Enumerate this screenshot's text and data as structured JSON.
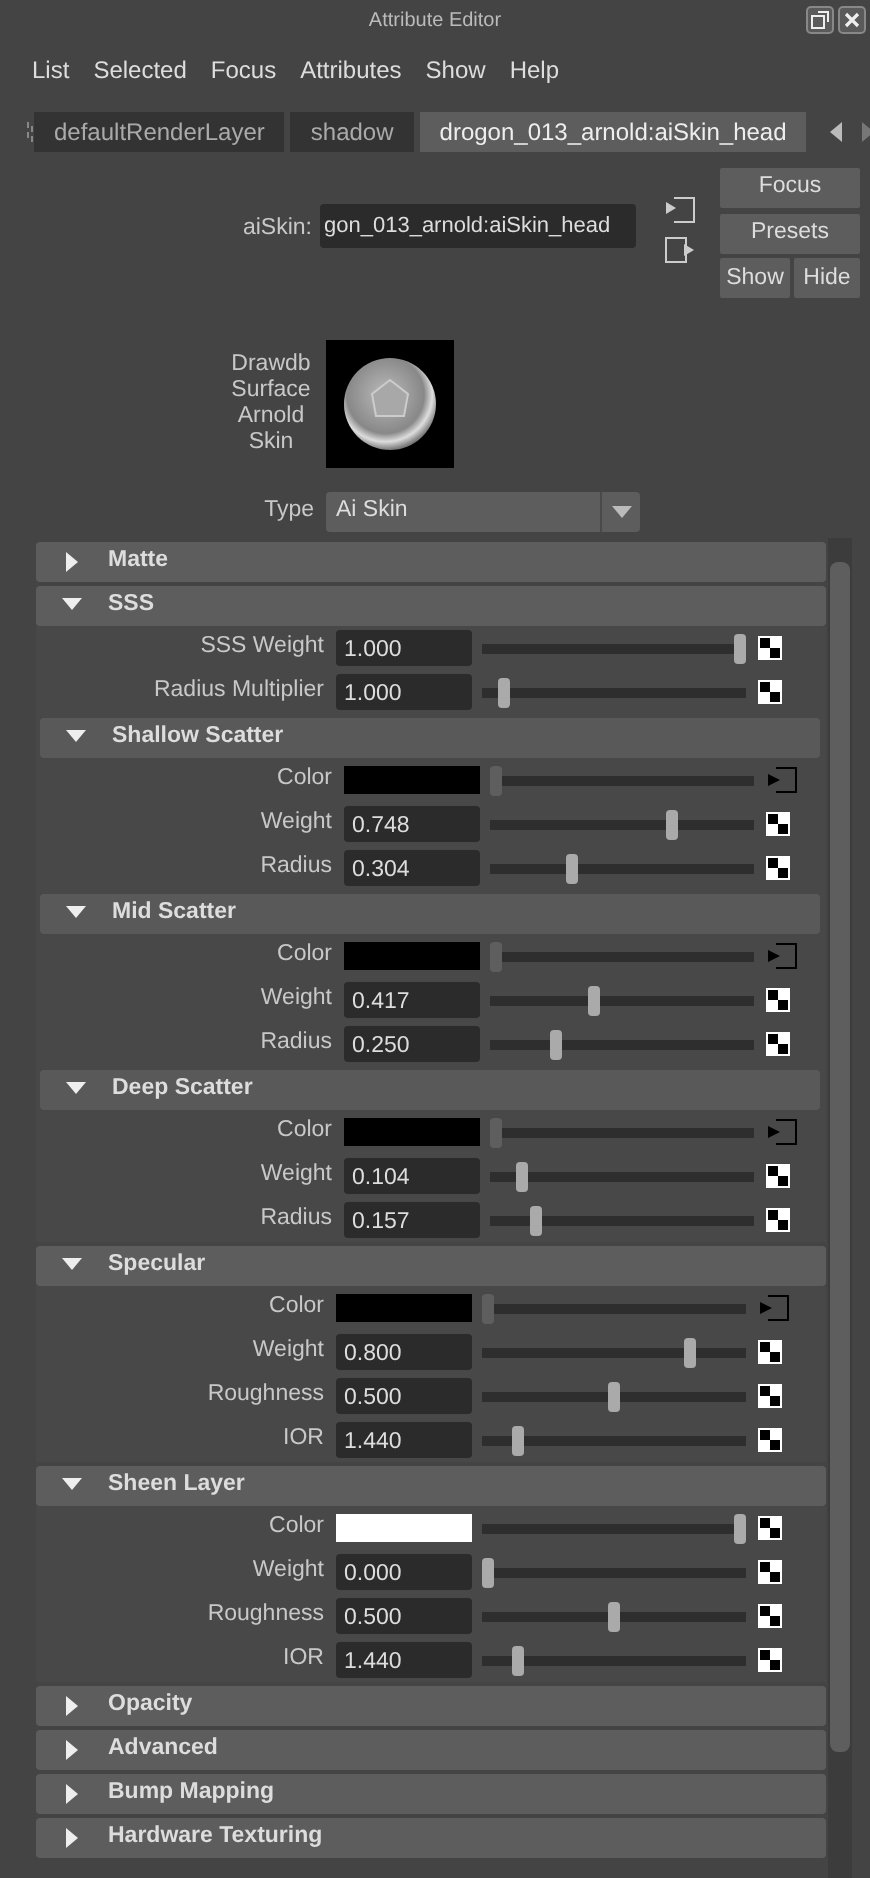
{
  "window": {
    "title": "Attribute Editor"
  },
  "menu": [
    "List",
    "Selected",
    "Focus",
    "Attributes",
    "Show",
    "Help"
  ],
  "tabs": [
    {
      "label": "defaultRenderLayer",
      "selected": false
    },
    {
      "label": "shadow",
      "selected": false
    },
    {
      "label": "drogon_013_arnold:aiSkin_head",
      "selected": true
    }
  ],
  "node": {
    "label": "aiSkin:",
    "value": "gon_013_arnold:aiSkin_head"
  },
  "buttons": [
    "Focus",
    "Presets",
    "Show",
    "Hide"
  ],
  "swatch": {
    "label": "Drawdb Surface Arnold Skin"
  },
  "type": {
    "label": "Type",
    "value": "Ai Skin"
  },
  "sections": [
    {
      "title": "Matte",
      "expanded": false
    },
    {
      "title": "SSS",
      "expanded": true,
      "attributes": [
        {
          "kind": "number",
          "label": "SSS Weight",
          "value": "1.000",
          "level": 1.0,
          "map_button": {
            "kind": "checker"
          }
        },
        {
          "kind": "number",
          "label": "Radius Multiplier",
          "value": "1.000",
          "level": 0.06,
          "map_button": {
            "kind": "checker"
          }
        }
      ],
      "subsections": [
        {
          "title": "Shallow Scatter",
          "expanded": true,
          "attributes": [
            {
              "kind": "color",
              "label": "Color",
              "color": "#000000",
              "level": 0,
              "map_button": {
                "kind": "output"
              }
            },
            {
              "kind": "number",
              "label": "Weight",
              "value": "0.748",
              "level": 0.7,
              "map_button": {
                "kind": "checker"
              }
            },
            {
              "kind": "number",
              "label": "Radius",
              "value": "0.304",
              "level": 0.3,
              "map_button": {
                "kind": "checker"
              }
            }
          ]
        },
        {
          "title": "Mid Scatter",
          "expanded": true,
          "attributes": [
            {
              "kind": "color",
              "label": "Color",
              "color": "#000000",
              "level": 0,
              "map_button": {
                "kind": "output"
              }
            },
            {
              "kind": "number",
              "label": "Weight",
              "value": "0.417",
              "level": 0.39,
              "map_button": {
                "kind": "checker"
              }
            },
            {
              "kind": "number",
              "label": "Radius",
              "value": "0.250",
              "level": 0.24,
              "map_button": {
                "kind": "checker"
              }
            }
          ]
        },
        {
          "title": "Deep Scatter",
          "expanded": true,
          "attributes": [
            {
              "kind": "color",
              "label": "Color",
              "color": "#000000",
              "level": 0,
              "map_button": {
                "kind": "output"
              }
            },
            {
              "kind": "number",
              "label": "Weight",
              "value": "0.104",
              "level": 0.1,
              "map_button": {
                "kind": "checker"
              }
            },
            {
              "kind": "number",
              "label": "Radius",
              "value": "0.157",
              "level": 0.16,
              "map_button": {
                "kind": "checker"
              }
            }
          ]
        }
      ]
    },
    {
      "title": "Specular",
      "expanded": true,
      "attributes": [
        {
          "kind": "color",
          "label": "Color",
          "color": "#000000",
          "level": 0,
          "map_button": {
            "kind": "output"
          }
        },
        {
          "kind": "number",
          "label": "Weight",
          "value": "0.800",
          "level": 0.8,
          "map_button": {
            "kind": "checker"
          }
        },
        {
          "kind": "number",
          "label": "Roughness",
          "value": "0.500",
          "level": 0.5,
          "map_button": {
            "kind": "checker"
          }
        },
        {
          "kind": "number",
          "label": "IOR",
          "value": "1.440",
          "level": 0.12,
          "map_button": {
            "kind": "checker"
          }
        }
      ]
    },
    {
      "title": "Sheen Layer",
      "expanded": true,
      "attributes": [
        {
          "kind": "color",
          "label": "Color",
          "color": "#ffffff",
          "level": 1.0,
          "map_button": {
            "kind": "checker"
          }
        },
        {
          "kind": "number",
          "label": "Weight",
          "value": "0.000",
          "level": 0,
          "map_button": {
            "kind": "checker"
          }
        },
        {
          "kind": "number",
          "label": "Roughness",
          "value": "0.500",
          "level": 0.5,
          "map_button": {
            "kind": "checker"
          }
        },
        {
          "kind": "number",
          "label": "IOR",
          "value": "1.440",
          "level": 0.12,
          "map_button": {
            "kind": "checker"
          }
        }
      ]
    },
    {
      "title": "Opacity",
      "expanded": false
    },
    {
      "title": "Advanced",
      "expanded": false
    },
    {
      "title": "Bump Mapping",
      "expanded": false
    },
    {
      "title": "Hardware Texturing",
      "expanded": false
    }
  ]
}
